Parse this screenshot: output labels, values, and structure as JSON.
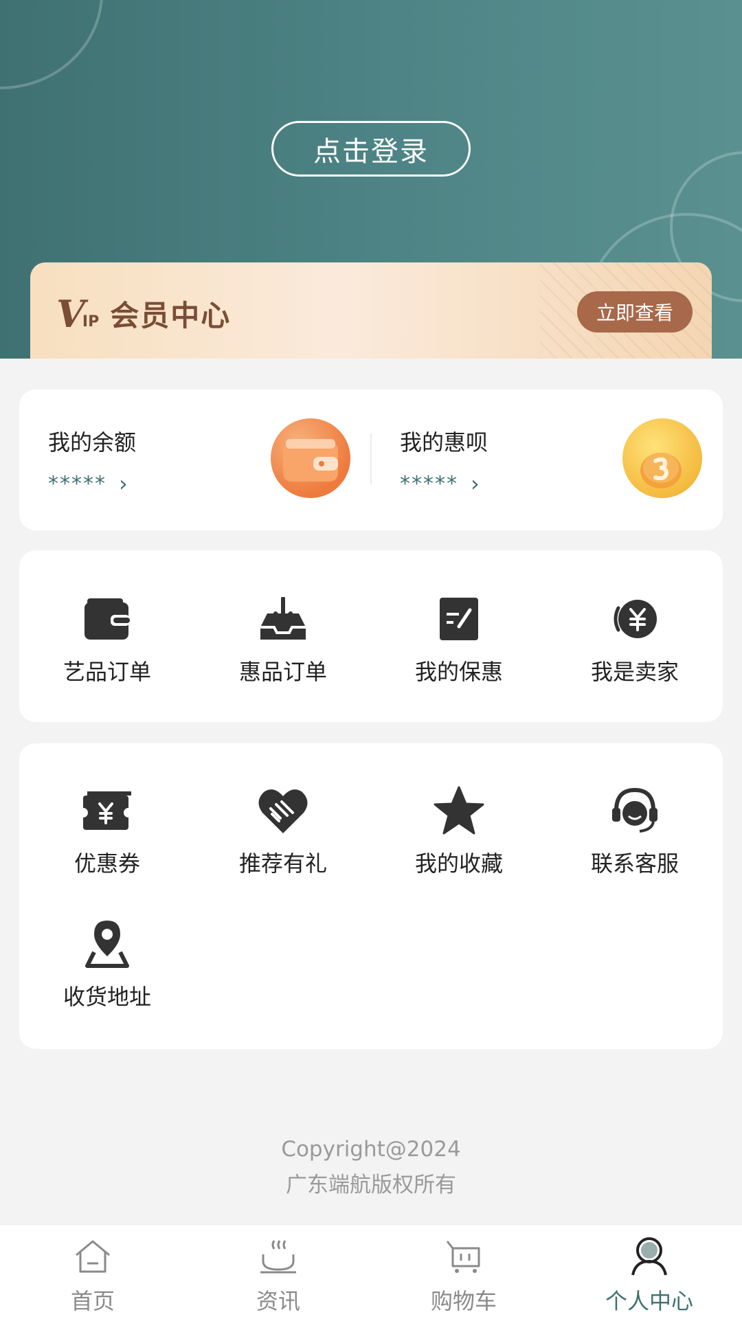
{
  "header": {
    "login_label": "点击登录"
  },
  "vip": {
    "badge_v": "V",
    "badge_ip": "IP",
    "title": "会员中心",
    "button_label": "立即查看"
  },
  "balance": {
    "left": {
      "label": "我的余额",
      "value": "*****",
      "icon": "wallet-icon"
    },
    "right": {
      "label": "我的惠呗",
      "value": "*****",
      "icon": "coin-icon"
    }
  },
  "orders": [
    {
      "label": "艺品订单",
      "icon": "wallet-icon"
    },
    {
      "label": "惠品订单",
      "icon": "inbox-download-icon"
    },
    {
      "label": "我的保惠",
      "icon": "edit-note-icon"
    },
    {
      "label": "我是卖家",
      "icon": "yuan-coin-icon"
    }
  ],
  "services": [
    {
      "label": "优惠券",
      "icon": "coupon-icon"
    },
    {
      "label": "推荐有礼",
      "icon": "handshake-heart-icon"
    },
    {
      "label": "我的收藏",
      "icon": "star-icon"
    },
    {
      "label": "联系客服",
      "icon": "headset-icon"
    },
    {
      "label": "收货地址",
      "icon": "location-pin-icon"
    }
  ],
  "footer": {
    "line1": "Copyright@2024",
    "line2": "广东端航版权所有"
  },
  "tabbar": [
    {
      "label": "首页",
      "icon": "home-icon",
      "active": false
    },
    {
      "label": "资讯",
      "icon": "news-bowl-icon",
      "active": false
    },
    {
      "label": "购物车",
      "icon": "cart-icon",
      "active": false
    },
    {
      "label": "个人中心",
      "icon": "profile-icon",
      "active": true
    }
  ],
  "colors": {
    "theme": "#3f7172",
    "vip_brown": "#a8684a",
    "background": "#f3f3f3"
  }
}
